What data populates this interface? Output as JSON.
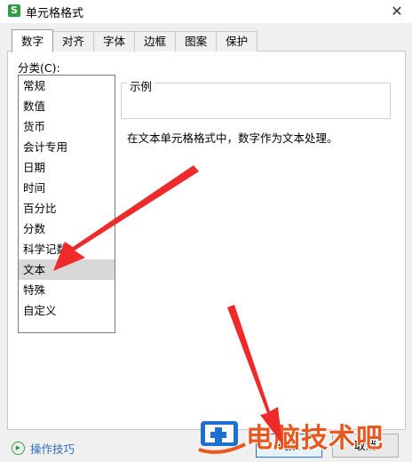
{
  "window": {
    "title": "单元格格式",
    "app_icon_letter": "S",
    "close_glyph": "✕"
  },
  "tabs": [
    {
      "label": "数字",
      "active": true
    },
    {
      "label": "对齐"
    },
    {
      "label": "字体"
    },
    {
      "label": "边框"
    },
    {
      "label": "图案"
    },
    {
      "label": "保护"
    }
  ],
  "category": {
    "label": "分类(C):",
    "items": [
      "常规",
      "数值",
      "货币",
      "会计专用",
      "日期",
      "时间",
      "百分比",
      "分数",
      "科学记数",
      "文本",
      "特殊",
      "自定义"
    ],
    "selected": "文本"
  },
  "sample": {
    "legend": "示例"
  },
  "description": "在文本单元格格式中，数字作为文本处理。",
  "footer": {
    "tips_label": "操作技巧",
    "ok_label": "确定",
    "cancel_label": "取消"
  },
  "watermark": {
    "text": "电脑技术吧"
  },
  "colors": {
    "annotation_arrow": "#ee2a2a",
    "watermark": "#e8581f",
    "accent_green": "#2e9e45"
  }
}
